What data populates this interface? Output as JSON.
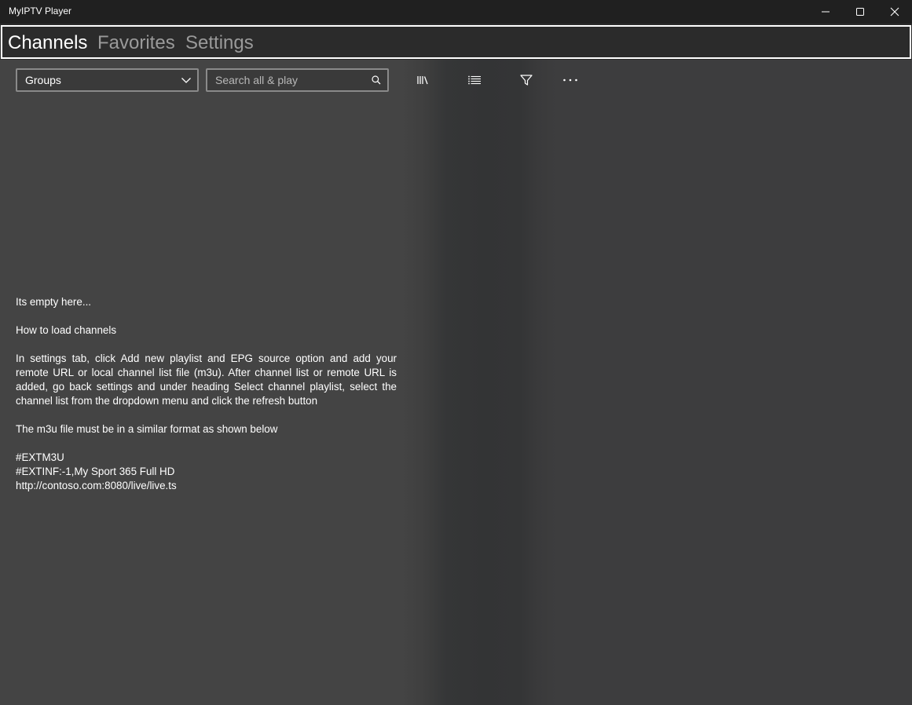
{
  "window": {
    "title": "MyIPTV Player"
  },
  "pivot": {
    "tabs": [
      {
        "label": "Channels",
        "active": true
      },
      {
        "label": "Favorites",
        "active": false
      },
      {
        "label": "Settings",
        "active": false
      }
    ]
  },
  "toolbar": {
    "groups_value": "Groups",
    "search_placeholder": "Search all & play",
    "icons": [
      "library-icon",
      "list-icon",
      "filter-icon",
      "more-icon"
    ]
  },
  "empty_state": {
    "line1": "Its empty here...",
    "line2": "How to load  channels",
    "instructions": "In settings tab, click Add new playlist and EPG source  option and add your remote URL or local channel list file (m3u). After channel list or remote URL is added, go back settings and under heading  Select channel playlist, select the channel list from the dropdown menu and click the refresh button",
    "format_note": "The m3u file must be in a similar format as shown below",
    "example_line1": "#EXTM3U",
    "example_line2": "#EXTINF:-1,My Sport 365 Full HD",
    "example_line3": "http://contoso.com:8080/live/live.ts"
  },
  "colors": {
    "background": "#444444",
    "titlebar": "#202020",
    "text": "#ffffff",
    "inactive_tab": "#9a9a9a"
  }
}
